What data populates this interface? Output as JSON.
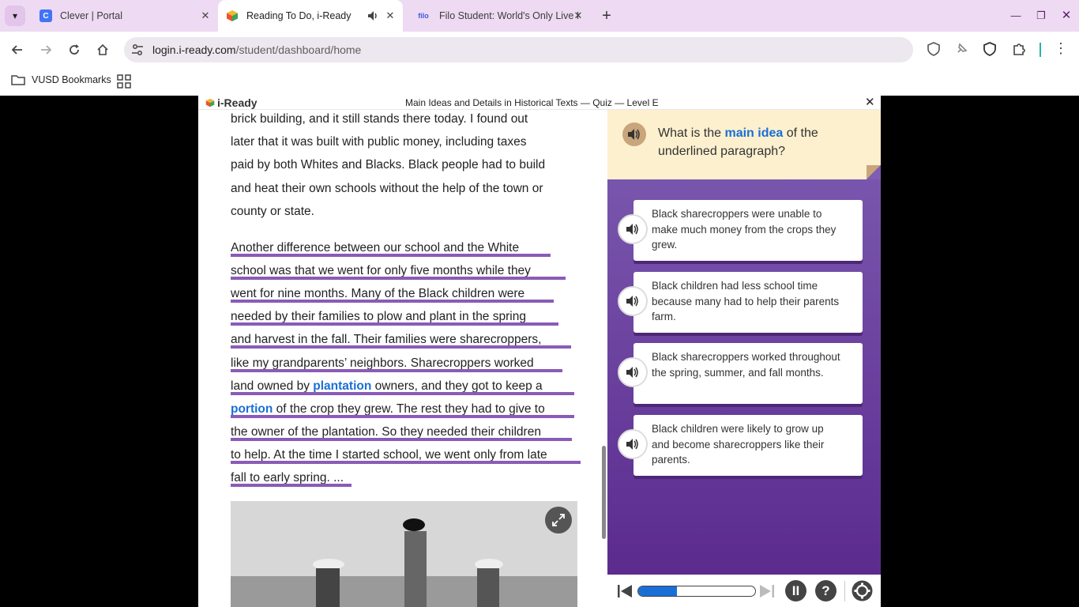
{
  "browser": {
    "tabs": [
      {
        "title": "Clever | Portal",
        "favicon": "clever-icon",
        "active": false
      },
      {
        "title": "Reading To Do, i-Ready",
        "favicon": "iready-icon",
        "active": true,
        "audio": true
      },
      {
        "title": "Filo Student: World's Only Live I",
        "favicon": "filo-icon",
        "active": false
      }
    ],
    "url_domain": "login.i-ready.com",
    "url_path": "/student/dashboard/home",
    "bookmarks_label": "VUSD Bookmarks"
  },
  "app": {
    "logo": "i-Ready",
    "title": "Main Ideas and Details in Historical Texts — Quiz — Level E",
    "close": "✕"
  },
  "passage": {
    "para1_lines": [
      "brick building, and it still stands there today. I found out",
      "later that it was built with public money, including taxes",
      "paid by both Whites and Blacks. Black people had to build",
      "and heat their own schools without the help of the town or",
      "county or state."
    ],
    "para2_lines": [
      {
        "text": "Another difference between our school and the White"
      },
      {
        "text": "school was that we went for only five months while they"
      },
      {
        "text": "went for nine months. Many of the Black children were"
      },
      {
        "text": "needed by their families to plow and plant in the spring"
      },
      {
        "text": "and harvest in the fall. Their families were sharecroppers,"
      },
      {
        "text": "like my grandparents’ neighbors. Sharecroppers worked"
      },
      {
        "pre": "land owned by ",
        "vocab": "plantation",
        "post": " owners, and they got to keep a"
      },
      {
        "pre": "",
        "vocab": "portion",
        "post": " of the crop they grew. The rest they had to give to"
      },
      {
        "text": "the owner of the plantation. So they needed their children"
      },
      {
        "text": "to help. At the time I started school, we went only from late"
      },
      {
        "text": "fall to early spring. ..."
      }
    ]
  },
  "question": {
    "pre": "What is the ",
    "highlight": "main idea",
    "post": " of the underlined paragraph?"
  },
  "choices": [
    "Black sharecroppers were unable to make much money from the crops they grew.",
    "Black children had less school time because many had to help their parents farm.",
    "Black sharecroppers worked throughout the spring, summer, and fall months.",
    "Black children were likely to grow up and become sharecroppers like their parents."
  ],
  "controls": {
    "progress_fraction": 0.33,
    "pause_label": "II",
    "help_label": "?"
  },
  "colors": {
    "accent_blue": "#1a6fd6",
    "underline_purple": "#8a5bb8",
    "panel_purple": "#6b3ea3",
    "prompt_bg": "#fdf0cf"
  }
}
